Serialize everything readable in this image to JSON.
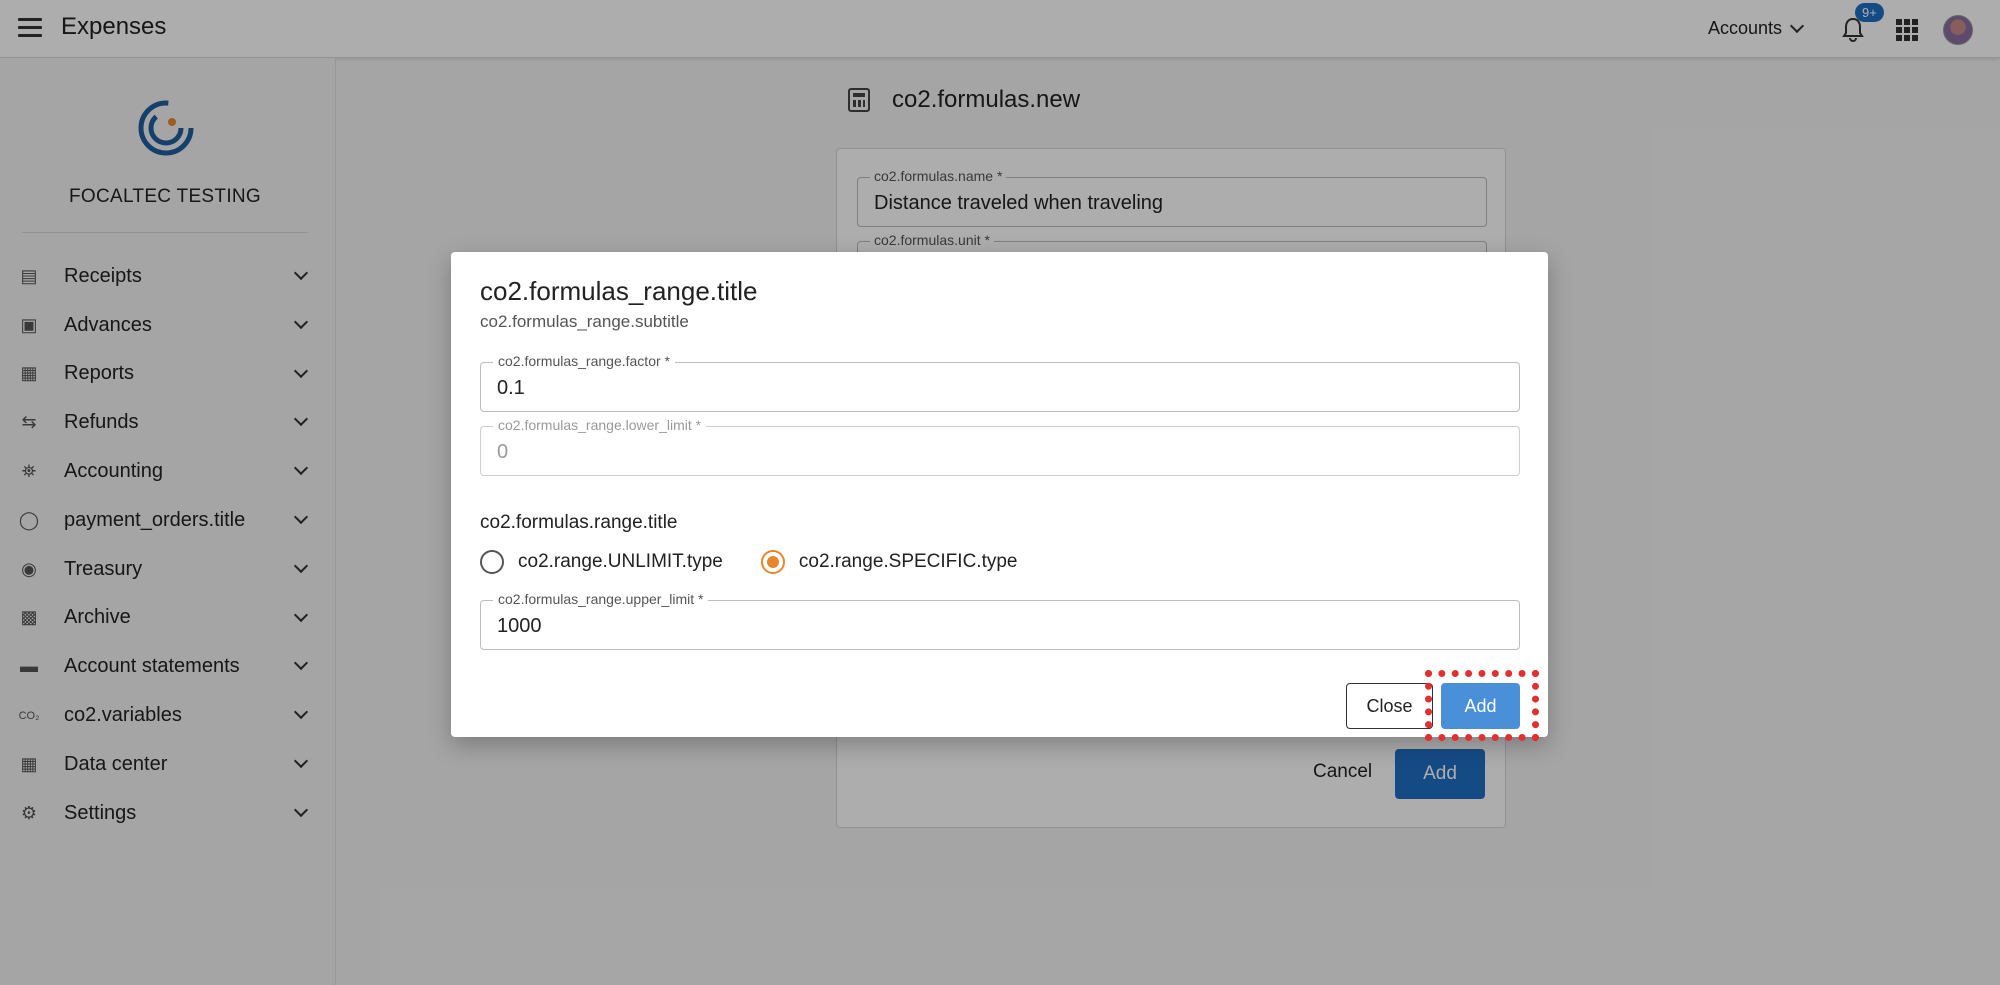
{
  "header": {
    "app_title": "Expenses",
    "accounts_label": "Accounts",
    "notification_badge": "9+"
  },
  "sidebar": {
    "company": "FOCALTEC TESTING",
    "items": [
      {
        "label": "Receipts",
        "icon": "receipt-icon"
      },
      {
        "label": "Advances",
        "icon": "money-icon"
      },
      {
        "label": "Reports",
        "icon": "report-icon"
      },
      {
        "label": "Refunds",
        "icon": "refund-icon"
      },
      {
        "label": "Accounting",
        "icon": "bank-icon"
      },
      {
        "label": "payment_orders.title",
        "icon": "coins-icon"
      },
      {
        "label": "Treasury",
        "icon": "piggy-bank-icon"
      },
      {
        "label": "Archive",
        "icon": "archive-icon"
      },
      {
        "label": "Account statements",
        "icon": "wallet-icon"
      },
      {
        "label": "co2.variables",
        "icon": "co2-icon"
      },
      {
        "label": "Data center",
        "icon": "data-icon"
      },
      {
        "label": "Settings",
        "icon": "gear-icon"
      }
    ]
  },
  "page": {
    "title": "co2.formulas.new",
    "name_label": "co2.formulas.name *",
    "name_value": "Distance traveled when traveling",
    "unit_label": "co2.formulas.unit *",
    "cancel_label": "Cancel",
    "add_label": "Add"
  },
  "dialog": {
    "title": "co2.formulas_range.title",
    "subtitle": "co2.formulas_range.subtitle",
    "factor_label": "co2.formulas_range.factor *",
    "factor_value": "0.1",
    "lower_label": "co2.formulas_range.lower_limit *",
    "lower_value": "0",
    "range_title": "co2.formulas.range.title",
    "radio_unlimit": "co2.range.UNLIMIT.type",
    "radio_specific": "co2.range.SPECIFIC.type",
    "upper_label": "co2.formulas_range.upper_limit *",
    "upper_value": "1000",
    "close_label": "Close",
    "add_label": "Add",
    "accent_color": "#e8862f",
    "primary_color": "#4a90d9"
  }
}
